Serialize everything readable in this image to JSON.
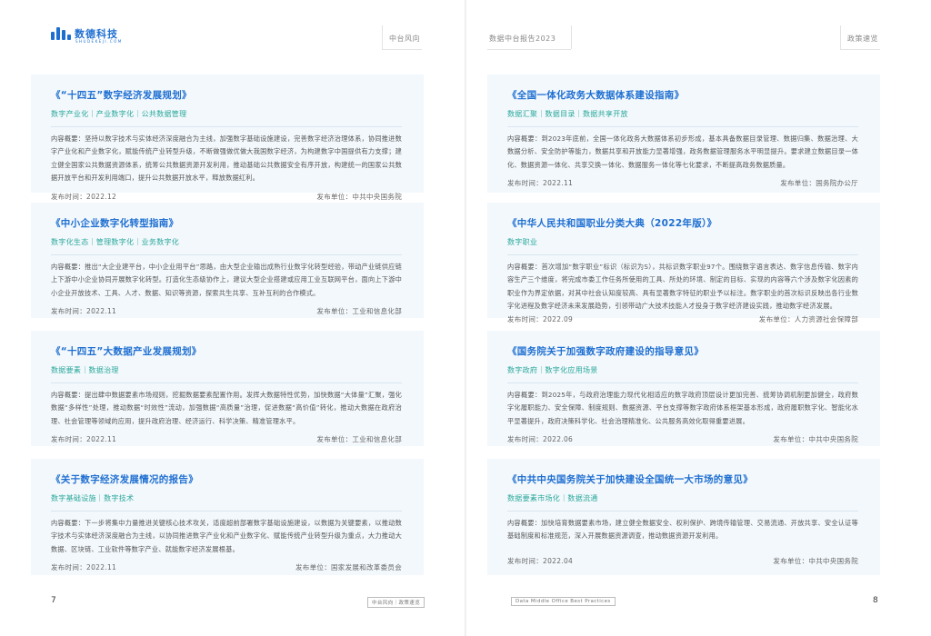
{
  "header": {
    "logo_text": "数德科技",
    "logo_sub": "SHUDEKEJI.COM",
    "left_right_text": "中台风向",
    "right_left_text": "数据中台报告2023",
    "right_right_text": "政策速览"
  },
  "labels": {
    "content_prefix": "内容概要：",
    "date_prefix": "发布时间：",
    "unit_prefix": "发布单位："
  },
  "cards": [
    {
      "title": "《“十四五”数字经济发展规划》",
      "tags": "数字产业化｜产业数字化｜公共数据管理",
      "body": "坚持以数字技术与实体经济深度融合为主线，加强数字基础设施建设，完善数字经济治理体系，协同推进数字产业化和产业数字化，赋能传统产业转型升级，不断做强做优做大我国数字经济，为构建数字中国提供有力支撑；建立健全国家公共数据资源体系，统筹公共数据资源开发利用，推动基础公共数据安全有序开放，构建统一的国家公共数据开放平台和开发利用端口，提升公共数据开放水平，释放数据红利。",
      "date": "2022.12",
      "unit": "中共中央国务院"
    },
    {
      "title": "《全国一体化政务大数据体系建设指南》",
      "tags": "数据汇聚｜数据目录｜数据共享开放",
      "body": "到2023年底前，全国一体化政务大数据体系初步形成，基本具备数据目录管理、数据归集、数据治理、大数据分析、安全防护等能力，数据共享和开放能力显著增强，政务数据管理服务水平明显提升。要求建立数据目录一体化、数据资源一体化、共享交换一体化、数据服务一体化等七化要求，不断提高政务数据质量。",
      "date": "2022.11",
      "unit": "国务院办公厅"
    },
    {
      "title": "《中小企业数字化转型指南》",
      "tags": "数字化生态｜管理数字化｜业务数字化",
      "body": "推出“大企业建平台，中小企业用平台”思路，由大型企业输出成熟行业数字化转型经验，带动产业链供应链上下游中小企业协同开展数字化转型。打造化生态级协作上，建议大型企业搭建或应用工业互联网平台，面向上下游中小企业开放技术、工具、人才、数据、知识等资源，探索共生共享、互补互利的合作模式。",
      "date": "2022.11",
      "unit": "工业和信息化部"
    },
    {
      "title": "《中华人民共和国职业分类大典（2022年版）》",
      "tags": "数字职业",
      "body": "首次增加“数字职业”标识（标识为S），共标识数字职业97个。围绕数字语言表达、数字信息传输、数字内容生产三个维度，将完成市委工作任务所使用的工具、所处的环境、制定的目标、实现的内容等六个涉及数字化因素的职业作为界定依据，对其中社会认知度较高、具有显著数字特征的职业予以标注。数字职业的首次标识反映出各行业数字化进程及数字经济未来发展趋势，引领带动广大技术技能人才投身于数字经济建设实践，推动数字经济发展。",
      "date": "2022.09",
      "unit": "人力资源社会保障部"
    },
    {
      "title": "《“十四五”大数据产业发展规划》",
      "tags": "数据要素｜数据治理",
      "body": "提出肆中数据要素市场规则，挖掘数据要素配置作用。发挥大数据特性优势，加快数据“大体量”汇聚，强化数据“多样性”处理，推动数据“时效性”流动，加强数据“高质量”治理，促进数据“高价值”转化，推动大数据在政府治理、社会管理等领域的应用，提升政府治理、经济运行、科学决策、精准管理水平。",
      "date": "2022.11",
      "unit": "工业和信息化部"
    },
    {
      "title": "《国务院关于加强数字政府建设的指导意见》",
      "tags": "数字政府｜数字化应用场景",
      "body": "到2025年，与政府治理能力现代化相适应的数字政府顶层设计更加完善、统筹协调机制更加健全，政府数字化履职能力、安全保障、制度规则、数据资源、平台支撑等数字政府体系框架基本形成，政府履职数字化、智能化水平显著提升，政府决策科学化、社会治理精准化、公共服务高效化取得重要进展。",
      "date": "2022.06",
      "unit": "中共中央国务院"
    },
    {
      "title": "《关于数字经济发展情况的报告》",
      "tags": "数字基础设施｜数字技术",
      "body": "下一步将集中力量推进关键核心技术攻关，适度超前部署数字基础设施建设，以数据为关键要素，以推动数字技术与实体经济深度融合为主线，以协同推进数字产业化和产业数字化、赋能传统产业转型升级为重点，大力推动大数据、区块链、工业软件等数字产业、就能数字经济发展根基。",
      "date": "2022.11",
      "unit": "国家发展和改革委员会"
    },
    {
      "title": "《中共中央国务院关于加快建设全国统一大市场的意见》",
      "tags": "数据要素市场化｜数据流通",
      "body": "加快培育数据要素市场，建立健全数据安全、权利保护、跨境传输管理、交易流通、开放共享、安全认证等基础制度和标准规范，深入开展数据资源调查，推动数据资源开发利用。",
      "date": "2022.04",
      "unit": "中共中央国务院"
    }
  ],
  "footer": {
    "left_page": "7",
    "right_page": "8",
    "left_tag": "中台风向｜政策速览",
    "right_tag": "Data Middle Office Best Practices"
  }
}
